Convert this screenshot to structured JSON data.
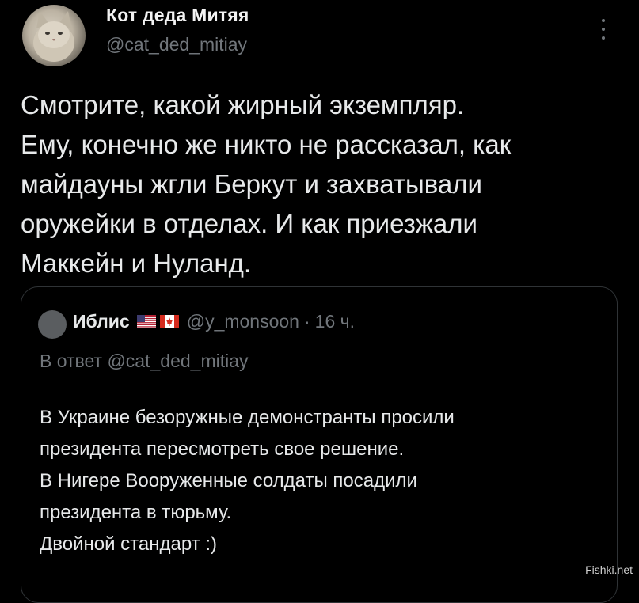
{
  "tweet": {
    "author_name": "Кот деда Митяя",
    "author_handle": "@cat_ded_mitiay",
    "text_lines": [
      "Смотрите, какой жирный экземпляр.",
      "Ему, конечно же никто не рассказал, как",
      "майдауны жгли Беркут и захватывали",
      "оружейки в отделах. И как приезжали",
      "Маккейн и Нуланд."
    ]
  },
  "quote": {
    "name": "Иблис",
    "flags": [
      "us-flag-icon",
      "canada-flag-icon"
    ],
    "handle": "@y_monsoon",
    "separator": "·",
    "time": "16 ч.",
    "reply_to": "В ответ @cat_ded_mitiay",
    "text_lines": [
      "В Украине безоружные демонстранты просили",
      "президента пересмотреть свое решение.",
      "В Нигере Вооруженные  солдаты посадили",
      "президента в тюрьму.",
      "Двойной стандарт :)"
    ]
  },
  "watermark": "Fishki.net",
  "colors": {
    "background": "#000000",
    "text": "#e7e9ea",
    "muted": "#71767b",
    "border": "#2f3336"
  }
}
